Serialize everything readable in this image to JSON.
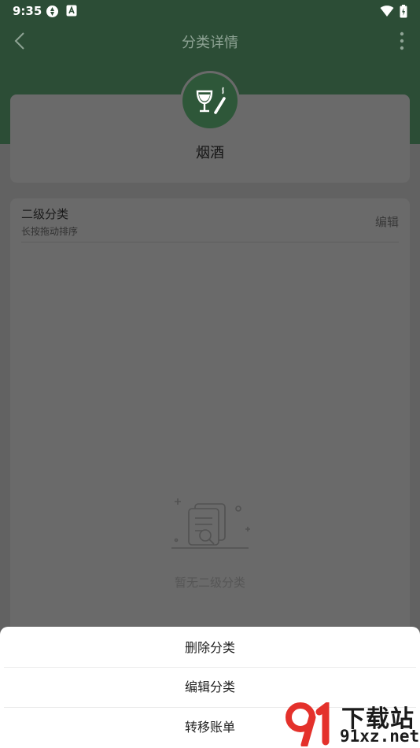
{
  "status_bar": {
    "time": "9:35"
  },
  "header": {
    "title": "分类详情"
  },
  "category": {
    "name": "烟酒"
  },
  "subcategory": {
    "title": "二级分类",
    "hint": "长按拖动排序",
    "edit_label": "编辑",
    "empty_text": "暂无二级分类"
  },
  "sheet": {
    "items": [
      {
        "label": "删除分类"
      },
      {
        "label": "编辑分类"
      },
      {
        "label": "转移账单"
      }
    ]
  },
  "watermark": {
    "brand": "下载站",
    "url": "91xz.net"
  },
  "colors": {
    "brand_green": "#2c4d36",
    "accent_red": "#e4312b"
  }
}
